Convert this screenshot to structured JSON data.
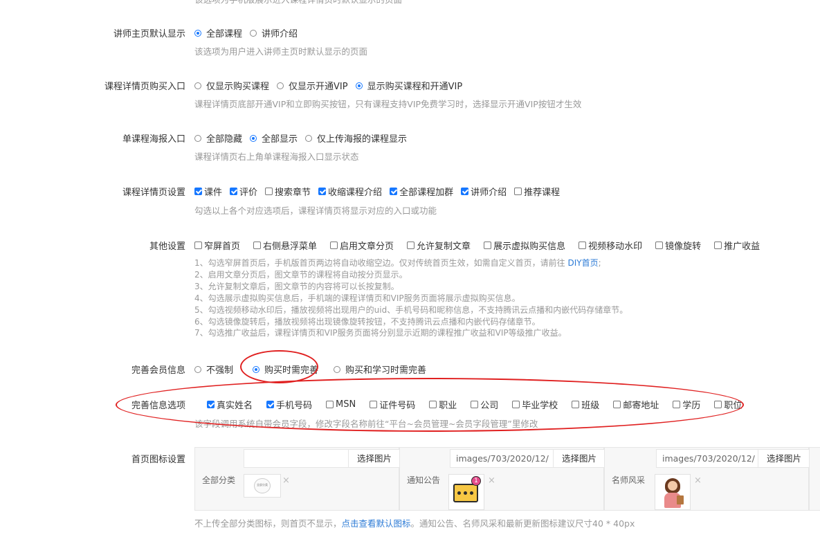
{
  "top_hint": "该选项为手机版展示进入课程详情页时默认显示的页面",
  "teacher_home": {
    "label": "讲师主页默认显示",
    "options": [
      "全部课程",
      "讲师介绍"
    ],
    "selected": 0,
    "hint": "该选项为用户进入讲师主页时默认显示的页面"
  },
  "buy_entry": {
    "label": "课程详情页购买入口",
    "options": [
      "仅显示购买课程",
      "仅显示开通VIP",
      "显示购买课程和开通VIP"
    ],
    "selected": 2,
    "hint": "课程详情页底部开通VIP和立即购买按钮，只有课程支持VIP免费学习时，选择显示开通VIP按钮才生效"
  },
  "poster_entry": {
    "label": "单课程海报入口",
    "options": [
      "全部隐藏",
      "全部显示",
      "仅上传海报的课程显示"
    ],
    "selected": 1,
    "hint": "课程详情页右上角单课程海报入口显示状态"
  },
  "detail_settings": {
    "label": "课程详情页设置",
    "options": [
      {
        "text": "课件",
        "checked": true
      },
      {
        "text": "评价",
        "checked": true
      },
      {
        "text": "搜索章节",
        "checked": false
      },
      {
        "text": "收缩课程介绍",
        "checked": true
      },
      {
        "text": "全部课程加群",
        "checked": true
      },
      {
        "text": "讲师介绍",
        "checked": true
      },
      {
        "text": "推荐课程",
        "checked": false
      }
    ],
    "hint": "勾选以上各个对应选项后，课程详情页将显示对应的入口或功能"
  },
  "other_settings": {
    "label": "其他设置",
    "options": [
      {
        "text": "窄屏首页",
        "checked": false
      },
      {
        "text": "右侧悬浮菜单",
        "checked": false
      },
      {
        "text": "启用文章分页",
        "checked": false
      },
      {
        "text": "允许复制文章",
        "checked": false
      },
      {
        "text": "展示虚拟购买信息",
        "checked": false
      },
      {
        "text": "视频移动水印",
        "checked": false
      },
      {
        "text": "镜像旋转",
        "checked": false
      },
      {
        "text": "推广收益",
        "checked": false
      }
    ],
    "note1_pre": "1、勾选窄屏首页后，手机版首页两边将自动收缩空边。仅对传统首页生效，如需自定义首页，请前往 ",
    "note1_link": "DIY首页",
    "note1_post": ";",
    "notes": [
      "2、启用文章分页后，图文章节的课程将自动按分页显示。",
      "3、允许复制文章后，图文章节的内容将可以长按复制。",
      "4、勾选展示虚拟购买信息后，手机端的课程详情页和VIP服务页面将展示虚拟购买信息。",
      "5、勾选视频移动水印后，播放视频将出现用户的uid、手机号码和昵称信息，不支持腾讯云点播和内嵌代码存储章节。",
      "6、勾选镜像旋转后，播放视频将出现镜像旋转按钮，不支持腾讯云点播和内嵌代码存储章节。",
      "7、勾选推广收益后，课程详情页和VIP服务页面将分别显示近期的课程推广收益和VIP等级推广收益。"
    ]
  },
  "member_info": {
    "label": "完善会员信息",
    "options": [
      "不强制",
      "购买时需完善",
      "购买和学习时需完善"
    ],
    "selected": 1
  },
  "info_options": {
    "label": "完善信息选项",
    "options": [
      {
        "text": "真实姓名",
        "checked": true
      },
      {
        "text": "手机号码",
        "checked": true
      },
      {
        "text": "MSN",
        "checked": false
      },
      {
        "text": "证件号码",
        "checked": false
      },
      {
        "text": "职业",
        "checked": false
      },
      {
        "text": "公司",
        "checked": false
      },
      {
        "text": "毕业学校",
        "checked": false
      },
      {
        "text": "班级",
        "checked": false
      },
      {
        "text": "邮寄地址",
        "checked": false
      },
      {
        "text": "学历",
        "checked": false
      },
      {
        "text": "职位",
        "checked": false
      }
    ],
    "hint": "该字段调用系统自带会员字段，修改字段名称前往“平台~会员管理~会员字段管理”里修改"
  },
  "home_icons": {
    "label": "首页图标设置",
    "pick_label": "选择图片",
    "remove_glyph": "×",
    "items": [
      {
        "name": "全部分类",
        "path": "",
        "thumb_text": "全部分类"
      },
      {
        "name": "通知公告",
        "path": "images/703/2020/12/",
        "badge": "1"
      },
      {
        "name": "名师风采",
        "path": "images/703/2020/12/"
      }
    ],
    "hint_pre": "不上传全部分类图标，则首页不显示，",
    "hint_link": "点击查看默认图标",
    "hint_post": "。通知公告、名师风采和最新更新图标建议尺寸40 * 40px"
  },
  "colors": {
    "accent": "#1677ff",
    "annotation": "#e02020",
    "hint": "#999999",
    "link": "#2d7bd6"
  }
}
